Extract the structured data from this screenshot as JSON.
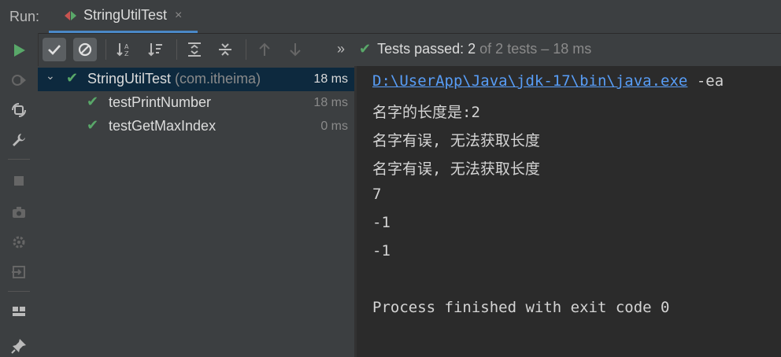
{
  "header": {
    "run_label": "Run:",
    "tab_title": "StringUtilTest",
    "tab_close": "×"
  },
  "toolbar": {
    "more": "»",
    "status": {
      "prefix": "Tests passed: 2",
      "suffix": "of 2 tests – 18 ms"
    }
  },
  "tree": {
    "root": {
      "name": "StringUtilTest",
      "package": "(com.itheima)",
      "time": "18 ms"
    },
    "children": [
      {
        "name": "testPrintNumber",
        "time": "18 ms"
      },
      {
        "name": "testGetMaxIndex",
        "time": "0 ms"
      }
    ]
  },
  "console": {
    "command_link": "D:\\UserApp\\Java\\jdk-17\\bin\\java.exe",
    "command_rest": " -ea",
    "lines": [
      "名字的长度是:2",
      "名字有误, 无法获取长度",
      "名字有误, 无法获取长度",
      "7",
      "-1",
      "-1",
      "",
      "Process finished with exit code 0"
    ]
  },
  "icons": {
    "check": "✔",
    "expand": "⌄"
  },
  "colors": {
    "accent": "#4a88c7",
    "pass_green": "#59a869",
    "link_blue": "#589df6",
    "selection": "#0d293e"
  }
}
